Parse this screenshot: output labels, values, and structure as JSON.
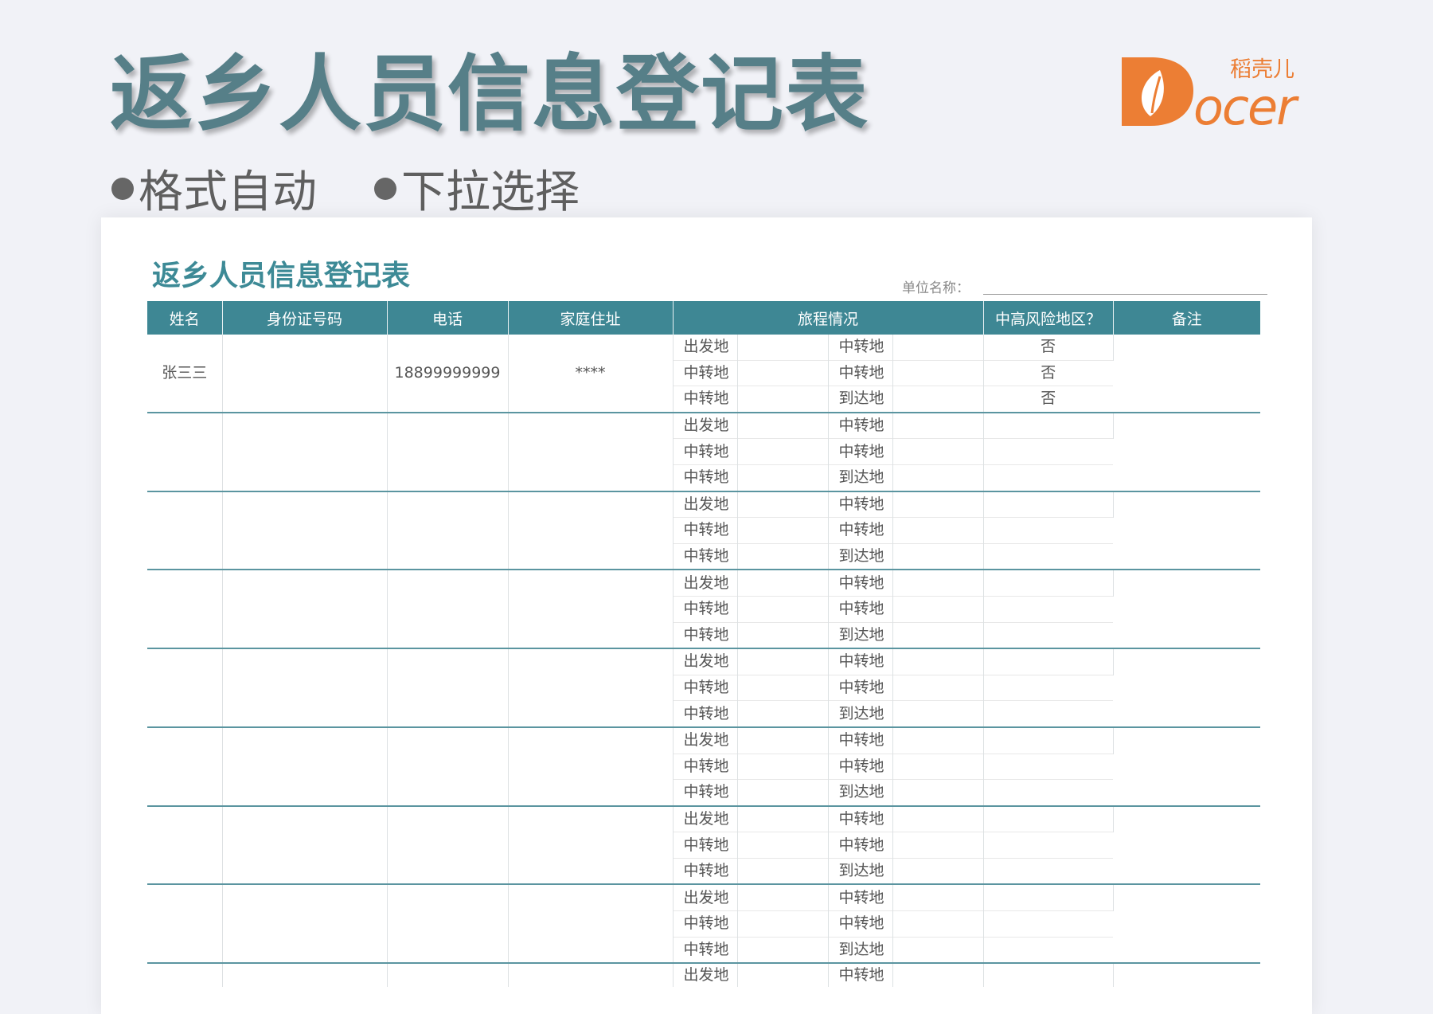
{
  "hero": {
    "title": "返乡人员信息登记表",
    "features": [
      "格式自动",
      "下拉选择"
    ]
  },
  "logo": {
    "letter": "D",
    "text": "ocer",
    "cn": "稻壳儿",
    "brand_color": "#ec7e34"
  },
  "sheet": {
    "title": "返乡人员信息登记表",
    "unit_label": "单位名称：",
    "headers": [
      "姓名",
      "身份证号码",
      "电话",
      "家庭住址",
      "旅程情况",
      "中高风险地区？",
      "备注"
    ],
    "groups": [
      {
        "name": "张三三",
        "id": "",
        "phone": "18899999999",
        "address": "****",
        "note": "",
        "legs": [
          {
            "from_label": "出发地",
            "from_value": "",
            "to_label": "中转地",
            "to_value": "",
            "risk": "否"
          },
          {
            "from_label": "中转地",
            "from_value": "",
            "to_label": "中转地",
            "to_value": "",
            "risk": "否"
          },
          {
            "from_label": "中转地",
            "from_value": "",
            "to_label": "到达地",
            "to_value": "",
            "risk": "否"
          }
        ]
      },
      {
        "name": "",
        "id": "",
        "phone": "",
        "address": "",
        "note": "",
        "legs": [
          {
            "from_label": "出发地",
            "from_value": "",
            "to_label": "中转地",
            "to_value": "",
            "risk": ""
          },
          {
            "from_label": "中转地",
            "from_value": "",
            "to_label": "中转地",
            "to_value": "",
            "risk": ""
          },
          {
            "from_label": "中转地",
            "from_value": "",
            "to_label": "到达地",
            "to_value": "",
            "risk": ""
          }
        ]
      },
      {
        "name": "",
        "id": "",
        "phone": "",
        "address": "",
        "note": "",
        "legs": [
          {
            "from_label": "出发地",
            "from_value": "",
            "to_label": "中转地",
            "to_value": "",
            "risk": ""
          },
          {
            "from_label": "中转地",
            "from_value": "",
            "to_label": "中转地",
            "to_value": "",
            "risk": ""
          },
          {
            "from_label": "中转地",
            "from_value": "",
            "to_label": "到达地",
            "to_value": "",
            "risk": ""
          }
        ]
      },
      {
        "name": "",
        "id": "",
        "phone": "",
        "address": "",
        "note": "",
        "legs": [
          {
            "from_label": "出发地",
            "from_value": "",
            "to_label": "中转地",
            "to_value": "",
            "risk": ""
          },
          {
            "from_label": "中转地",
            "from_value": "",
            "to_label": "中转地",
            "to_value": "",
            "risk": ""
          },
          {
            "from_label": "中转地",
            "from_value": "",
            "to_label": "到达地",
            "to_value": "",
            "risk": ""
          }
        ]
      },
      {
        "name": "",
        "id": "",
        "phone": "",
        "address": "",
        "note": "",
        "legs": [
          {
            "from_label": "出发地",
            "from_value": "",
            "to_label": "中转地",
            "to_value": "",
            "risk": ""
          },
          {
            "from_label": "中转地",
            "from_value": "",
            "to_label": "中转地",
            "to_value": "",
            "risk": ""
          },
          {
            "from_label": "中转地",
            "from_value": "",
            "to_label": "到达地",
            "to_value": "",
            "risk": ""
          }
        ]
      },
      {
        "name": "",
        "id": "",
        "phone": "",
        "address": "",
        "note": "",
        "legs": [
          {
            "from_label": "出发地",
            "from_value": "",
            "to_label": "中转地",
            "to_value": "",
            "risk": ""
          },
          {
            "from_label": "中转地",
            "from_value": "",
            "to_label": "中转地",
            "to_value": "",
            "risk": ""
          },
          {
            "from_label": "中转地",
            "from_value": "",
            "to_label": "到达地",
            "to_value": "",
            "risk": ""
          }
        ]
      },
      {
        "name": "",
        "id": "",
        "phone": "",
        "address": "",
        "note": "",
        "legs": [
          {
            "from_label": "出发地",
            "from_value": "",
            "to_label": "中转地",
            "to_value": "",
            "risk": ""
          },
          {
            "from_label": "中转地",
            "from_value": "",
            "to_label": "中转地",
            "to_value": "",
            "risk": ""
          },
          {
            "from_label": "中转地",
            "from_value": "",
            "to_label": "到达地",
            "to_value": "",
            "risk": ""
          }
        ]
      },
      {
        "name": "",
        "id": "",
        "phone": "",
        "address": "",
        "note": "",
        "legs": [
          {
            "from_label": "出发地",
            "from_value": "",
            "to_label": "中转地",
            "to_value": "",
            "risk": ""
          },
          {
            "from_label": "中转地",
            "from_value": "",
            "to_label": "中转地",
            "to_value": "",
            "risk": ""
          },
          {
            "from_label": "中转地",
            "from_value": "",
            "to_label": "到达地",
            "to_value": "",
            "risk": ""
          }
        ]
      },
      {
        "name": "",
        "id": "",
        "phone": "",
        "address": "",
        "note": "",
        "legs": [
          {
            "from_label": "出发地",
            "from_value": "",
            "to_label": "中转地",
            "to_value": "",
            "risk": ""
          }
        ]
      }
    ]
  }
}
